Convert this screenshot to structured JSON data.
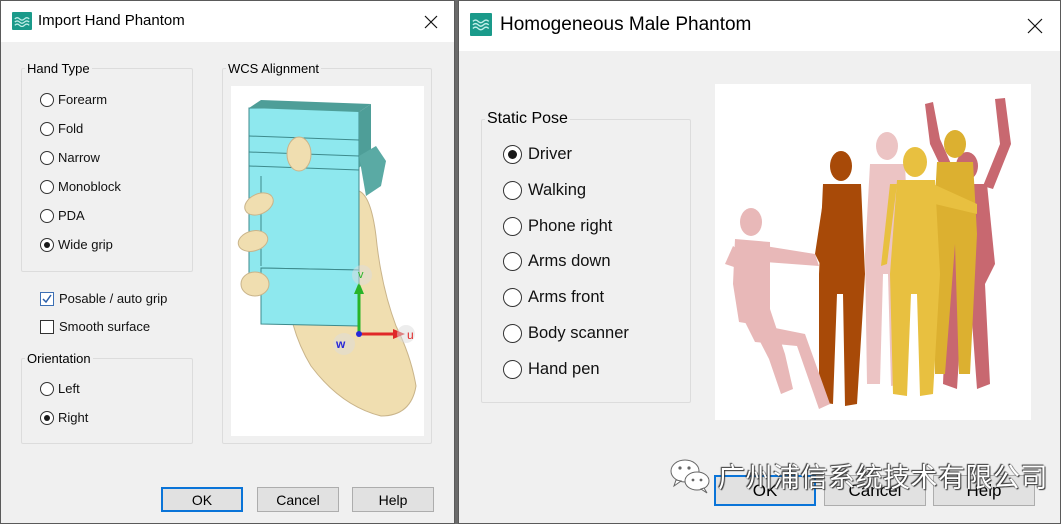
{
  "left_dialog": {
    "title": "Import Hand Phantom",
    "icon": "waves-app-icon",
    "close_icon": "close-x-icon",
    "hand_type": {
      "label": "Hand Type",
      "options": [
        {
          "label": "Forearm",
          "selected": false
        },
        {
          "label": "Fold",
          "selected": false
        },
        {
          "label": "Narrow",
          "selected": false
        },
        {
          "label": "Monoblock",
          "selected": false
        },
        {
          "label": "PDA",
          "selected": false
        },
        {
          "label": "Wide grip",
          "selected": true
        }
      ]
    },
    "checkboxes": [
      {
        "label": "Posable / auto grip",
        "checked": true
      },
      {
        "label": "Smooth surface",
        "checked": false
      }
    ],
    "orientation": {
      "label": "Orientation",
      "options": [
        {
          "label": "Left",
          "selected": false
        },
        {
          "label": "Right",
          "selected": true
        }
      ]
    },
    "wcs_alignment": {
      "label": "WCS Alignment",
      "axes": {
        "u": "u",
        "v": "v",
        "w": "w"
      },
      "colors": {
        "device": "#8ee8ee",
        "hand": "#f0deb0",
        "u_axis": "#e02828",
        "v_axis": "#28b428",
        "w_axis": "#2828d8"
      }
    },
    "buttons": {
      "ok": "OK",
      "cancel": "Cancel",
      "help": "Help"
    }
  },
  "right_dialog": {
    "title": "Homogeneous Male Phantom",
    "icon": "waves-app-icon",
    "close_icon": "close-x-icon",
    "static_pose": {
      "label": "Static Pose",
      "options": [
        {
          "label": "Driver",
          "selected": true
        },
        {
          "label": "Walking",
          "selected": false
        },
        {
          "label": "Phone right",
          "selected": false
        },
        {
          "label": "Arms down",
          "selected": false
        },
        {
          "label": "Arms front",
          "selected": false
        },
        {
          "label": "Body scanner",
          "selected": false
        },
        {
          "label": "Hand pen",
          "selected": false
        }
      ]
    },
    "preview": {
      "description": "phantom-poses-preview",
      "colors": {
        "driver": "#e8b8b8",
        "walking": "#a84a08",
        "phone": "#ecc4c4",
        "arms_front": "#e8c040",
        "arms_down": "#e0b430",
        "scanner": "#c86870"
      }
    },
    "buttons": {
      "ok": "OK",
      "cancel": "Cancel",
      "help": "Help"
    }
  },
  "watermark": {
    "text": "广州浦信系统技术有限公司",
    "icon": "wechat-icon"
  },
  "accent": "#0a74d8",
  "app_icon_color": "#1a9a8a"
}
